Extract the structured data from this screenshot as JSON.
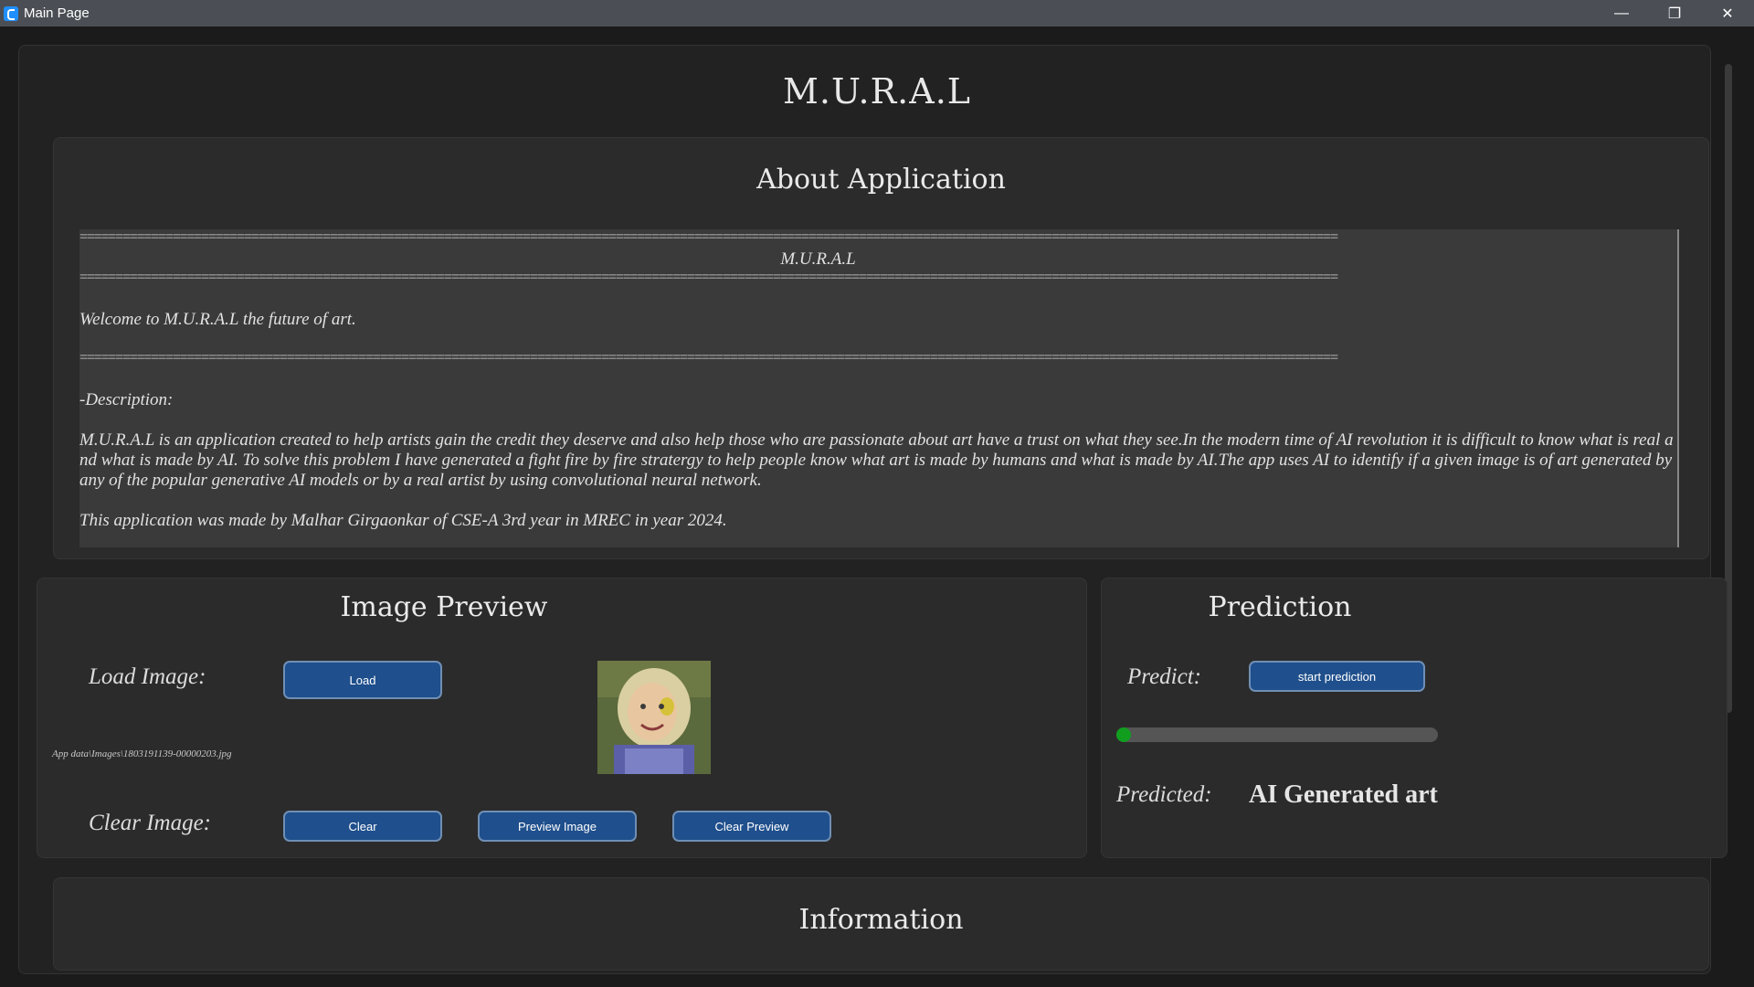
{
  "window": {
    "title": "Main Page",
    "controls": {
      "minimize": "—",
      "maximize": "❐",
      "close": "✕"
    }
  },
  "app": {
    "title": "M.U.R.A.L"
  },
  "about": {
    "title": "About Application",
    "rule": "================================================================================================================================================================================",
    "heading": "M.U.R.A.L",
    "welcome": "Welcome to M.U.R.A.L the future of art.",
    "description_label": "-Description:",
    "description": "M.U.R.A.L is an application created to help artists gain the credit they deserve and also help those who are passionate about art have a trust on what they see.In the modern time of AI revolution it is difficult to know what is real and what is made by AI. To solve this problem I have generated a fight fire by fire stratergy to help people know what art is made by humans and what is made by AI.The app uses AI to identify if a given image is of art generated by any of the popular generative AI models or by a real artist by using convolutional neural network.",
    "credits": "This application was made by Malhar Girgaonkar of CSE-A 3rd year in MREC in year 2024."
  },
  "preview": {
    "title": "Image Preview",
    "load_label": "Load Image:",
    "load_button": "Load",
    "file_path": "App data\\Images\\1803191139-00000203.jpg",
    "clear_label": "Clear Image:",
    "clear_button": "Clear",
    "preview_button": "Preview Image",
    "clear_preview_button": "Clear Preview"
  },
  "prediction": {
    "title": "Prediction",
    "predict_label": "Predict:",
    "start_button": "start prediction",
    "progress": 0.03,
    "predicted_label": "Predicted:",
    "result": "AI Generated art"
  },
  "info": {
    "title": "Information"
  },
  "colors": {
    "background": "#1b1b1b",
    "card": "#2b2b2b",
    "button": "#1f4f8c",
    "button_border": "#6f8fb5",
    "progress_fill": "#119e1f",
    "titlebar": "#4b4f55"
  }
}
